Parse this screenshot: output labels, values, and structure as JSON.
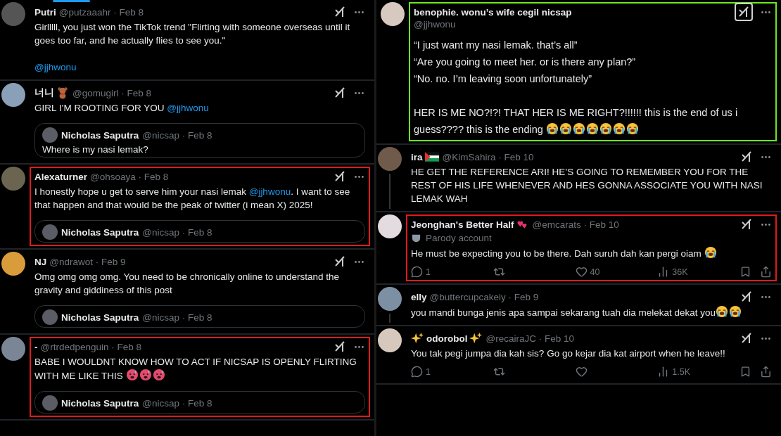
{
  "left_column": {
    "tweets": [
      {
        "kind": "reply",
        "name": [
          {
            "kind": "text",
            "text": "Putri"
          }
        ],
        "meta": "@putzaaahr · Feb 8",
        "body": [
          {
            "kind": "text",
            "text": "Girlllll, you just won the TikTok trend \"Flirting with someone overseas until it goes too far, and he actually flies to see you.\"\n\n"
          },
          {
            "kind": "mention",
            "text": "@jjhwonu"
          }
        ]
      },
      {
        "kind": "reply",
        "name": [
          {
            "kind": "text",
            "text": "너니"
          },
          {
            "kind": "teddy-bear"
          }
        ],
        "meta": "@gomugirl · Feb 8",
        "body": [
          {
            "kind": "text",
            "text": "GIRL I’M ROOTING FOR YOU "
          },
          {
            "kind": "mention",
            "text": "@jjhwonu"
          }
        ],
        "quote": {
          "name": "Nicholas Saputra",
          "meta": "@nicsap · Feb 8",
          "text": "Where is my nasi lemak?"
        }
      },
      {
        "kind": "reply",
        "name": [
          {
            "kind": "text",
            "text": "Alexaturner"
          }
        ],
        "meta": "@ohsoaya · Feb 8",
        "color": "#e3191c",
        "body": [
          {
            "kind": "text",
            "text": "I honestly hope u get to serve him your nasi lemak "
          },
          {
            "kind": "mention",
            "text": "@jjhwonu"
          },
          {
            "kind": "text",
            "text": ". I want to see that happen and that would be the peak of twitter (i mean X) 2025!"
          }
        ],
        "quote": {
          "name": "Nicholas Saputra",
          "meta": "@nicsap · Feb 8"
        }
      },
      {
        "kind": "reply",
        "name": [
          {
            "kind": "text",
            "text": "NJ"
          }
        ],
        "meta": "@ndrawot · Feb 9",
        "body": [
          {
            "kind": "text",
            "text": "Omg omg omg omg. You need to be chronically online to understand the gravity and giddiness of this post"
          }
        ],
        "quote": {
          "name": "Nicholas Saputra",
          "meta": "@nicsap · Feb 8"
        }
      },
      {
        "kind": "reply",
        "name": [
          {
            "kind": "text",
            "text": "-"
          }
        ],
        "meta": "@rtrdedpenguin · Feb 8",
        "color": "#e3191c",
        "body": [
          {
            "kind": "text",
            "text": "BABE I WOULDNT KNOW HOW TO ACT IF NICSAP IS OPENLY FLIRTING WITH ME LIKE THIS "
          },
          {
            "kind": "hot-face"
          },
          {
            "kind": "hot-face"
          },
          {
            "kind": "hot-face"
          }
        ],
        "quote": {
          "name": "Nicholas Saputra",
          "meta": "@nicsap · Feb 8"
        }
      }
    ]
  },
  "right_column": {
    "tweets": [
      {
        "kind": "main",
        "name": [
          {
            "kind": "text",
            "text": "benophie. wonu’s wife cegil nicsap"
          }
        ],
        "meta": "@jjhwonu",
        "color": "#6ee61f",
        "body": [
          {
            "kind": "text",
            "text": "“I just want my nasi lemak. that’s all”\n“Are you going to meet her. or is there any plan?”\n“No. no. I’m leaving soon unfortunately”\n\nHER IS ME NO?!?! THAT HER IS ME RIGHT?!!!!!! this is the end of us i guess???? this is the ending "
          },
          {
            "kind": "crying-face"
          },
          {
            "kind": "crying-face"
          },
          {
            "kind": "crying-face"
          },
          {
            "kind": "crying-face"
          },
          {
            "kind": "crying-face"
          },
          {
            "kind": "crying-face"
          },
          {
            "kind": "crying-face"
          }
        ]
      },
      {
        "kind": "reply",
        "thread_line": true,
        "name": [
          {
            "kind": "text",
            "text": "ira"
          },
          {
            "kind": "flag"
          }
        ],
        "meta": "@KimSahira · Feb 10",
        "body": [
          {
            "kind": "text",
            "text": "HE GET THE REFERENCE ARI! HE’S GOING TO REMEMBER YOU FOR THE REST OF HIS LIFE WHENEVER AND HES GONNA ASSOCIATE YOU WITH NASI LEMAK WAH"
          }
        ]
      },
      {
        "kind": "reply",
        "name": [
          {
            "kind": "text",
            "text": "Jeonghan's Better Half"
          },
          {
            "kind": "hearts"
          }
        ],
        "meta": "@emcarats · Feb 10",
        "badge": "Parody account",
        "color": "#e3191c",
        "body": [
          {
            "kind": "text",
            "text": "He must be expecting you to be there. Dah suruh dah kan pergi oiam "
          },
          {
            "kind": "crying-face"
          }
        ],
        "actions": {
          "replies": "1",
          "likes": "40",
          "views": "36K"
        }
      },
      {
        "kind": "reply",
        "thread_line": true,
        "name": [
          {
            "kind": "text",
            "text": "elly"
          }
        ],
        "meta": "@buttercupcakeiy · Feb 9",
        "body": [
          {
            "kind": "text",
            "text": "you mandi bunga jenis apa sampai sekarang tuah dia melekat dekat you"
          },
          {
            "kind": "crying-face"
          },
          {
            "kind": "crying-face"
          }
        ]
      },
      {
        "kind": "reply",
        "name": [
          {
            "kind": "sparkles"
          },
          {
            "kind": "text",
            "text": "odorobol"
          },
          {
            "kind": "sparkles"
          }
        ],
        "meta": "@recairaJC · Feb 10",
        "body": [
          {
            "kind": "text",
            "text": "You tak pegi jumpa dia kah sis? Go go kejar dia kat airport when he leave!!"
          }
        ],
        "actions": {
          "replies": "1",
          "views": "1.5K"
        }
      }
    ]
  }
}
